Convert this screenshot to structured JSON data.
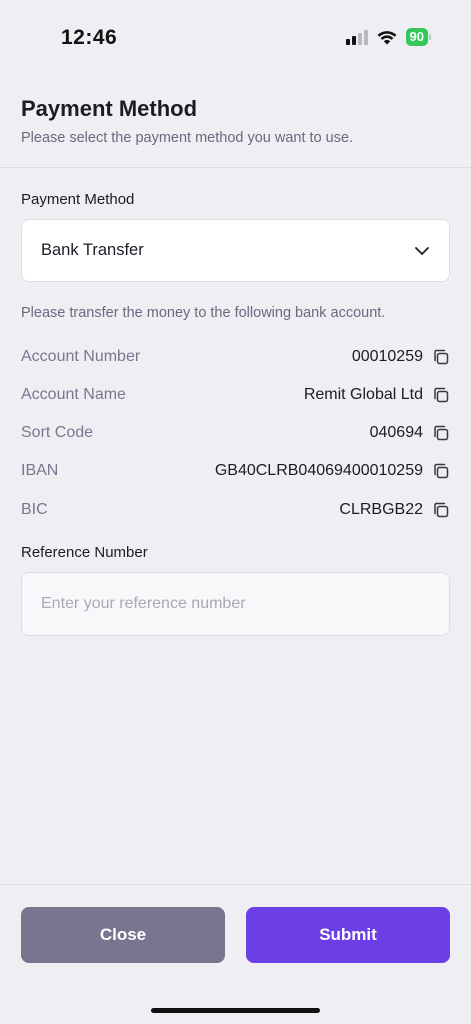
{
  "status_bar": {
    "time": "12:46",
    "battery": "90"
  },
  "header": {
    "title": "Payment Method",
    "subtitle": "Please select the payment method you want to use."
  },
  "payment_method": {
    "label": "Payment Method",
    "selected": "Bank Transfer"
  },
  "instruction": "Please transfer the money to the following bank account.",
  "bank_details": [
    {
      "label": "Account Number",
      "value": "00010259"
    },
    {
      "label": "Account Name",
      "value": "Remit Global Ltd"
    },
    {
      "label": "Sort Code",
      "value": "040694"
    },
    {
      "label": "IBAN",
      "value": "GB40CLRB04069400010259"
    },
    {
      "label": "BIC",
      "value": "CLRBGB22"
    }
  ],
  "reference": {
    "label": "Reference Number",
    "value": "",
    "placeholder": "Enter your reference number"
  },
  "buttons": {
    "close": "Close",
    "submit": "Submit"
  },
  "colors": {
    "accent": "#6b3ee6",
    "secondary": "#79758e",
    "battery": "#34c759"
  }
}
